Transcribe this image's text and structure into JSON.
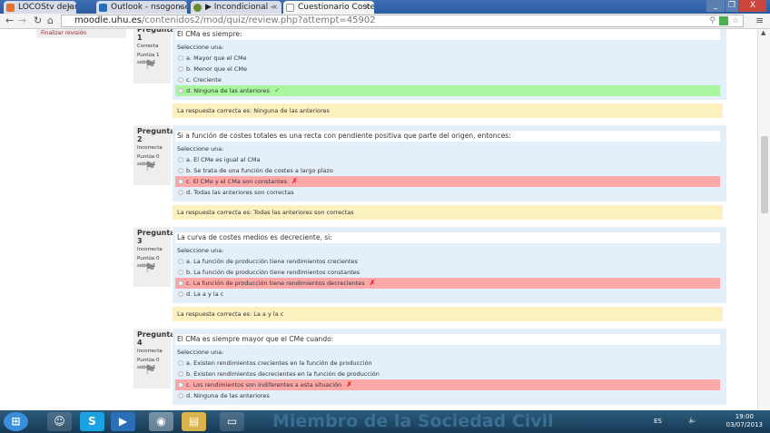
{
  "browser": {
    "tabs": [
      {
        "label": "LOCOStv deJamónyC",
        "color": "#e8702a"
      },
      {
        "label": "Outlook - nsogonse",
        "color": "#1f6fc5"
      },
      {
        "label": "▶ Incondicional - ",
        "color": "#6a8f2a"
      },
      {
        "label": "Cuestionario Costes",
        "color": "#ffffff"
      }
    ],
    "url_host": "moodle.uhu.es",
    "url_path": "/contenidos2/mod/quiz/review.php?attempt=45902"
  },
  "sidebar": {
    "finish_review": "Finalizar revisión"
  },
  "select_label": "Seleccione una:",
  "questions": [
    {
      "label": "Pregunta",
      "number": "1",
      "state": "Correcta",
      "score": "Puntúa 1 sobre 1",
      "text": "El CMa es siempre:",
      "options": [
        "a. Mayor que el CMe",
        "b. Menor que el CMe",
        "c. Creciente",
        "d. Ninguna de las anteriores"
      ],
      "selected": 3,
      "result": "correct",
      "feedback": "La respuesta correcta es: Ninguna de las anteriores"
    },
    {
      "label": "Pregunta",
      "number": "2",
      "state": "Incorrecta",
      "score": "Puntúa 0 sobre 1",
      "text": "Si a función de costes totales es una recta con pendiente positiva que parte del origen, entonces:",
      "options": [
        "a. El CMe es igual al CMa",
        "b. Se trata de una función de costes a largo plazo",
        "c. El CMe y el CMa son constantes",
        "d. Todas las anteriores son correctas"
      ],
      "selected": 2,
      "result": "incorrect",
      "feedback": "La respuesta correcta es: Todas las anteriores son correctas"
    },
    {
      "label": "Pregunta",
      "number": "3",
      "state": "Incorrecta",
      "score": "Puntúa 0 sobre 1",
      "text": "La curva de costes medios es decreciente, si:",
      "options": [
        "a. La función de producción tiene rendimientos crecientes",
        "b. La función de producción tiene rendimientos constantes",
        "c. La función de producción tiene rendimientos decrecientes",
        "d. La a y la c"
      ],
      "selected": 2,
      "result": "incorrect",
      "feedback": "La respuesta correcta es: La a y la c"
    },
    {
      "label": "Pregunta",
      "number": "4",
      "state": "Incorrecta",
      "score": "Puntúa 0 sobre 1",
      "text": "El CMa es siempre mayor que el CMe cuando:",
      "options": [
        "a. Existen rendimientos crecientes en la función de producción",
        "b. Existen rendimientos decrecientes en la función de producción",
        "c. Los rendimientos son indiferentes a esta situación",
        "d. Ninguna de las anteriores"
      ],
      "selected": 2,
      "result": "incorrect",
      "feedback": ""
    }
  ],
  "marks": {
    "correct": "✓",
    "incorrect": "✗"
  },
  "taskbar": {
    "watermark": "Miembro de la  Sociedad Civil",
    "lang": "ES",
    "time": "19:00",
    "date": "03/07/2013"
  }
}
